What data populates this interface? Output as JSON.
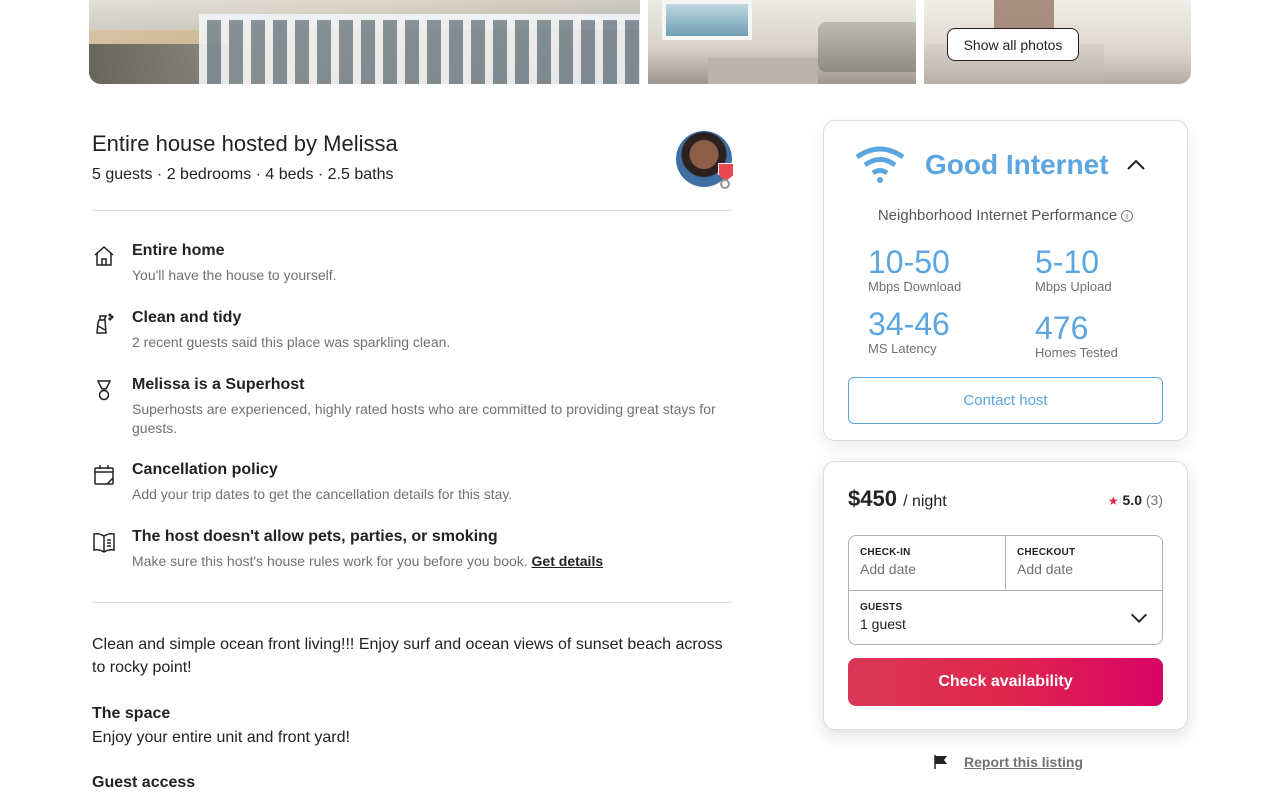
{
  "photos": {
    "show_all_label": "Show all photos"
  },
  "host": {
    "title": "Entire house hosted by Melissa",
    "details": "5 guests · 2 bedrooms · 4 beds · 2.5 baths"
  },
  "features": [
    {
      "icon": "home-icon",
      "title": "Entire home",
      "description": "You'll have the house to yourself."
    },
    {
      "icon": "spray-bottle-icon",
      "title": "Clean and tidy",
      "description": "2 recent guests said this place was sparkling clean."
    },
    {
      "icon": "superhost-medal-icon",
      "title": "Melissa is a Superhost",
      "description": "Superhosts are experienced, highly rated hosts who are committed to providing great stays for guests."
    },
    {
      "icon": "calendar-icon",
      "title": "Cancellation policy",
      "description": "Add your trip dates to get the cancellation details for this stay."
    },
    {
      "icon": "house-rules-book-icon",
      "title": "The host doesn't allow pets, parties, or smoking",
      "description": "Make sure this host's house rules work for you before you book.",
      "link": "Get details"
    }
  ],
  "description": {
    "intro": "Clean and simple ocean front living!!! Enjoy surf and ocean views of sunset beach across to rocky point!",
    "space_heading": "The space",
    "space_text": "Enjoy your entire unit and front yard!",
    "guest_access_heading": "Guest access"
  },
  "internet": {
    "title": "Good Internet",
    "subtitle": "Neighborhood Internet Performance",
    "stats": [
      {
        "value": "10-50",
        "label": "Mbps Download"
      },
      {
        "value": "5-10",
        "label": "Mbps Upload"
      },
      {
        "value": "34-46",
        "label": "MS Latency"
      },
      {
        "value": "476",
        "label": "Homes Tested"
      }
    ],
    "contact_label": "Contact host",
    "accent_color": "#5ba6e0"
  },
  "booking": {
    "price": "$450",
    "per_night": "/ night",
    "rating": "5.0",
    "review_count": "(3)",
    "checkin_label": "CHECK-IN",
    "checkin_value": "Add date",
    "checkout_label": "CHECKOUT",
    "checkout_value": "Add date",
    "guests_label": "GUESTS",
    "guests_value": "1 guest",
    "cta_label": "Check availability",
    "cta_color": "#e0264e"
  },
  "report": {
    "label": "Report this listing"
  }
}
